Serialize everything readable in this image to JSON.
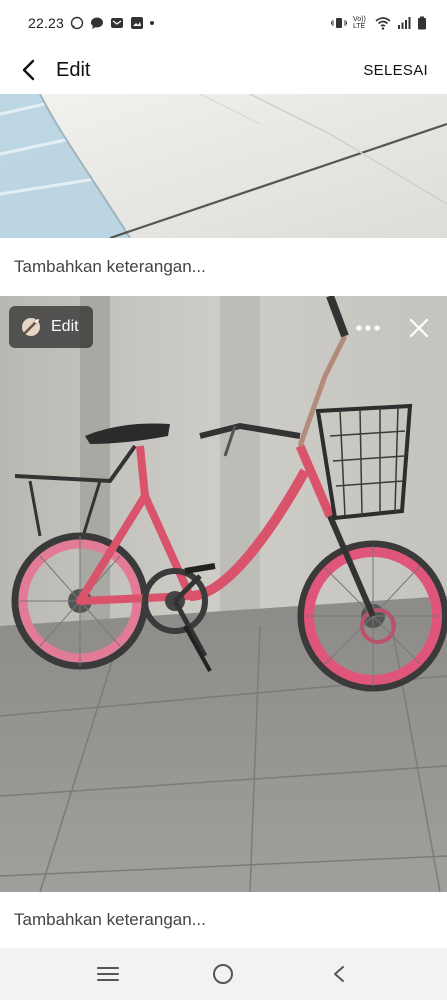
{
  "status_bar": {
    "time": "22.23",
    "icons_left": [
      "whatsapp-icon",
      "chat-bubble-icon",
      "mail-icon",
      "image-icon",
      "dot-icon"
    ],
    "icons_right": [
      "vibrate-icon",
      "volte-icon",
      "wifi-icon",
      "signal-icon",
      "battery-icon"
    ],
    "volte_label": "Vo)) LTE"
  },
  "app_bar": {
    "title": "Edit",
    "done_label": "SELESAI"
  },
  "photos": [
    {
      "caption_placeholder": "Tambahkan keterangan..."
    },
    {
      "caption_placeholder": "Tambahkan keterangan...",
      "edit_label": "Edit"
    }
  ],
  "nav_bar": {
    "buttons": [
      "recent-apps-icon",
      "home-icon",
      "back-icon"
    ]
  },
  "colors": {
    "bike_pink": "#d9536a",
    "nav_bg": "#f2f2f2"
  }
}
